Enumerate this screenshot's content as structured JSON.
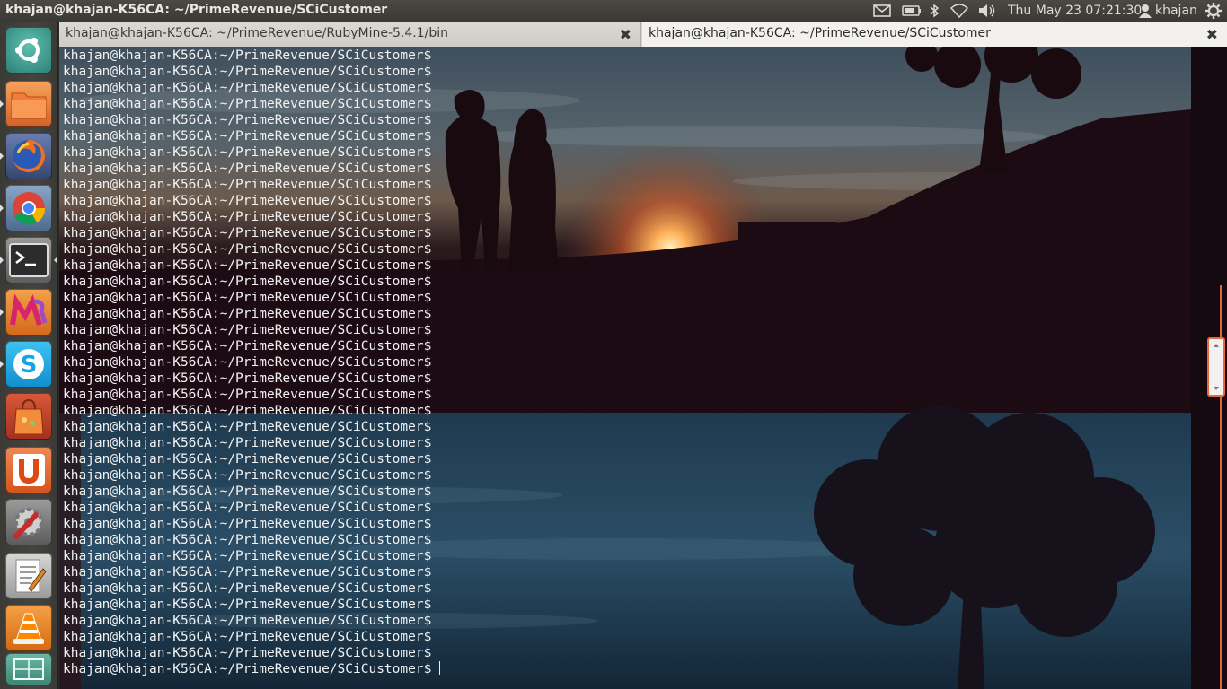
{
  "window_title": "khajan@khajan-K56CA: ~/PrimeRevenue/SCiCustomer",
  "panel": {
    "icons": [
      "mail-icon",
      "battery-icon",
      "bluetooth-icon",
      "wifi-icon",
      "volume-icon",
      "user-icon",
      "gear-icon"
    ],
    "clock": "Thu May 23 07:21:30",
    "user": "khajan"
  },
  "launcher": {
    "items": [
      {
        "name": "dash-home",
        "icon": "ubuntu-logo-icon"
      },
      {
        "name": "files",
        "icon": "folder-icon"
      },
      {
        "name": "firefox",
        "icon": "firefox-icon"
      },
      {
        "name": "chrome",
        "icon": "chrome-icon"
      },
      {
        "name": "terminal",
        "icon": "terminal-icon"
      },
      {
        "name": "rubymine",
        "icon": "rubymine-icon"
      },
      {
        "name": "skype",
        "icon": "skype-icon"
      },
      {
        "name": "software-center",
        "icon": "shopping-bag-icon"
      },
      {
        "name": "ubuntu-one",
        "icon": "ubuntu-one-icon"
      },
      {
        "name": "system-settings",
        "icon": "settings-icon"
      },
      {
        "name": "text-editor",
        "icon": "text-editor-icon"
      },
      {
        "name": "vlc",
        "icon": "vlc-icon"
      },
      {
        "name": "workspace-switcher",
        "icon": "workspace-icon"
      }
    ]
  },
  "tabs": [
    {
      "label": "khajan@khajan-K56CA: ~/PrimeRevenue/RubyMine-5.4.1/bin",
      "close": "✖"
    },
    {
      "label": "khajan@khajan-K56CA: ~/PrimeRevenue/SCiCustomer",
      "close": "✖"
    }
  ],
  "terminal": {
    "prompt": "khajan@khajan-K56CA:~/PrimeRevenue/SCiCustomer$",
    "line_count": 39
  },
  "colors": {
    "accent": "#e86a3e",
    "panel_bg": "#3c3b37",
    "terminal_text": "#f2f2f2"
  }
}
